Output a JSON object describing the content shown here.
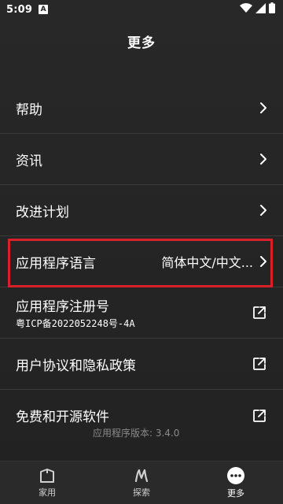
{
  "status_bar": {
    "time": "5:09",
    "notification_icon": "A"
  },
  "header": {
    "title": "更多"
  },
  "menu": {
    "help": "帮助",
    "news": "资讯",
    "improvement_plan": "改进计划",
    "app_language": "应用程序语言",
    "app_language_value": "简体中文/中文...",
    "registration": "应用程序注册号",
    "registration_number": "粤ICP备2022052248号-4A",
    "user_agreement": "用户协议和隐私政策",
    "open_source": "免费和开源软件"
  },
  "version": "应用程序版本: 3.4.0",
  "bottom_nav": {
    "home": "家用",
    "explore": "探索",
    "more": "更多"
  },
  "colors": {
    "highlight": "#d8202a",
    "background": "#242424"
  }
}
